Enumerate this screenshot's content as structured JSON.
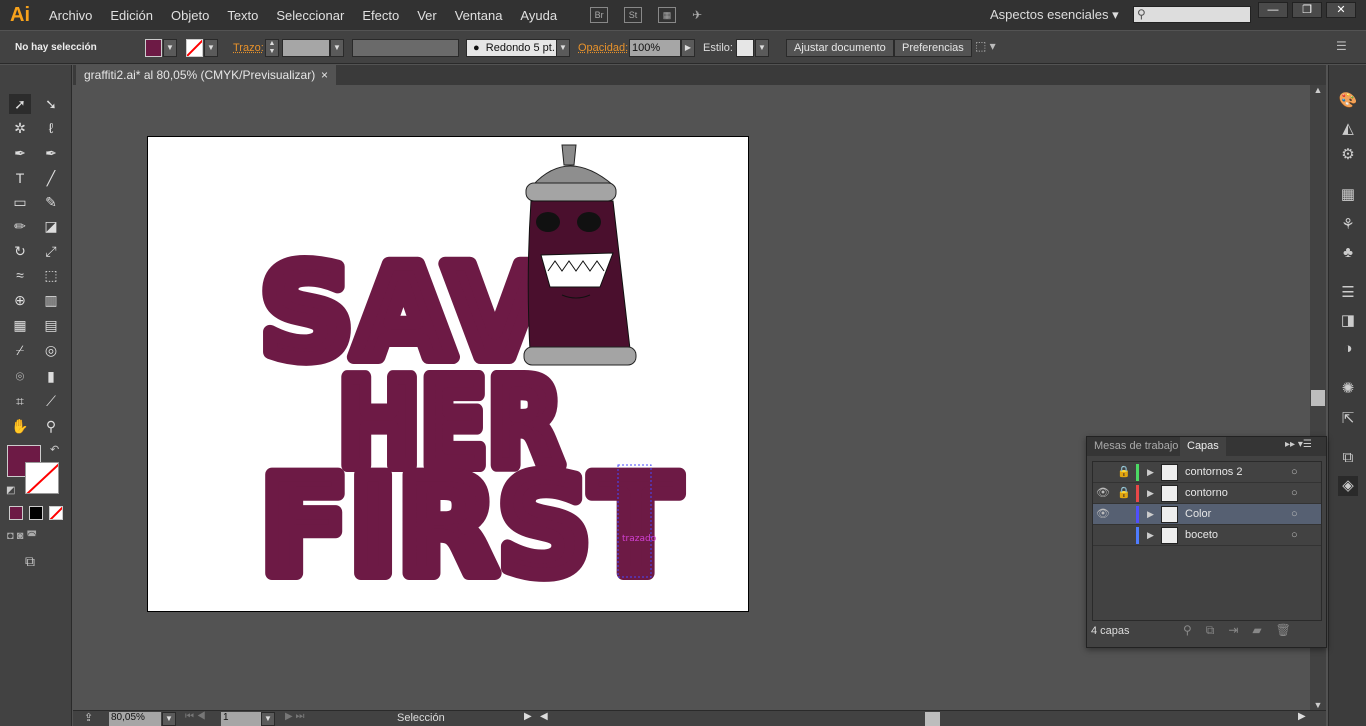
{
  "app": {
    "logo": "Ai",
    "menus": [
      "Archivo",
      "Edición",
      "Objeto",
      "Texto",
      "Seleccionar",
      "Efecto",
      "Ver",
      "Ventana",
      "Ayuda"
    ],
    "bridge": "Br",
    "stock": "St",
    "workspace": "Aspectos esenciales",
    "search_placeholder": "",
    "window_buttons": [
      "—",
      "❐",
      "✕"
    ]
  },
  "control": {
    "selection": "No hay selección",
    "fill_color": "#6d1a45",
    "stroke_label": "Trazo:",
    "brush": "Redondo 5 pt.",
    "opacity_label": "Opacidad:",
    "opacity": "100%",
    "style_label": "Estilo:",
    "fit_button": "Ajustar documento",
    "prefs_button": "Preferencias"
  },
  "document": {
    "tab_title": "graffiti2.ai* al 80,05% (CMYK/Previsualizar)",
    "close": "×"
  },
  "artwork": {
    "lettering": [
      "SAV",
      "HER",
      "FIRST"
    ],
    "path_label": "trazado",
    "color": "#6d1a45",
    "can_color": "#4a0f2d"
  },
  "layers_panel": {
    "tabs": [
      "Mesas de trabajo",
      "Capas"
    ],
    "active_tab": "Capas",
    "layers": [
      {
        "name": "contornos 2",
        "visible": false,
        "locked": true,
        "color": "#4cd964",
        "selected": false
      },
      {
        "name": "contorno",
        "visible": true,
        "locked": true,
        "color": "#e84848",
        "selected": false
      },
      {
        "name": "Color",
        "visible": true,
        "locked": false,
        "color": "#4f4fff",
        "selected": true
      },
      {
        "name": "boceto",
        "visible": false,
        "locked": false,
        "color": "#4f7cff",
        "selected": false
      }
    ],
    "count": "4 capas"
  },
  "status": {
    "zoom": "80,05%",
    "artboard": "1",
    "tool": "Selección"
  }
}
